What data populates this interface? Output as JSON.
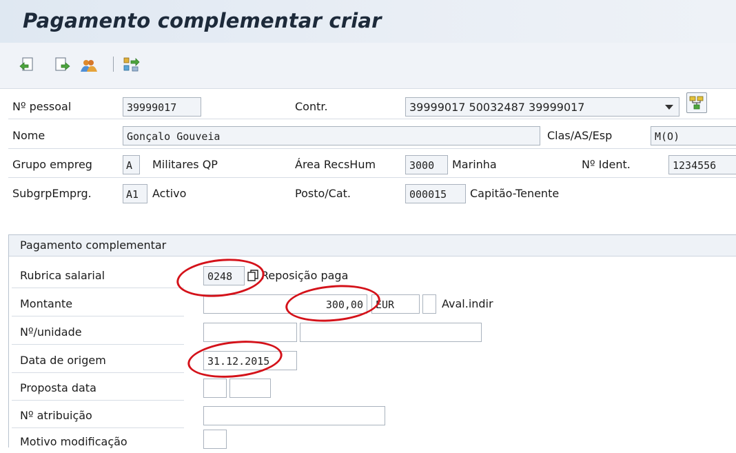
{
  "window": {
    "title": "Pagamento complementar criar"
  },
  "toolbar": {
    "icons": [
      "previous-icon",
      "next-icon",
      "overview-icon",
      "sort-icon"
    ]
  },
  "header": {
    "personnel_no": {
      "label": "Nº pessoal",
      "value": "39999017"
    },
    "contract": {
      "label": "Contr.",
      "value": "39999017 50032487 39999017"
    },
    "name": {
      "label": "Nome",
      "value": "Gonçalo Gouveia"
    },
    "class": {
      "label": "Clas/AS/Esp",
      "value": "M(O)"
    },
    "employee_group": {
      "label": "Grupo empreg",
      "code": "A",
      "text": "Militares QP"
    },
    "hr_area": {
      "label": "Área RecsHum",
      "code": "3000",
      "text": "Marinha"
    },
    "id_no": {
      "label": "Nº Ident.",
      "value": "1234556"
    },
    "employee_subgroup": {
      "label": "SubgrpEmprg.",
      "code": "A1",
      "text": "Activo"
    },
    "position": {
      "label": "Posto/Cat.",
      "code": "000015",
      "text": "Capitão-Tenente"
    }
  },
  "group": {
    "title": "Pagamento complementar",
    "wage_type": {
      "label": "Rubrica salarial",
      "value": "0248",
      "text": "Reposição paga"
    },
    "amount": {
      "label": "Montante",
      "value": "300,00",
      "currency": "EUR",
      "indirect_label": "Aval.indir"
    },
    "units": {
      "label": "Nº/unidade"
    },
    "origin_date": {
      "label": "Data de origem",
      "value": "31.12.2015"
    },
    "proposal_date": {
      "label": "Proposta data"
    },
    "assignment_no": {
      "label": "Nº atribuição"
    },
    "change_reason": {
      "label": "Motivo modificação"
    }
  },
  "colors": {
    "annotation": "#d4121a",
    "title_bar": "#dfe8f2"
  }
}
